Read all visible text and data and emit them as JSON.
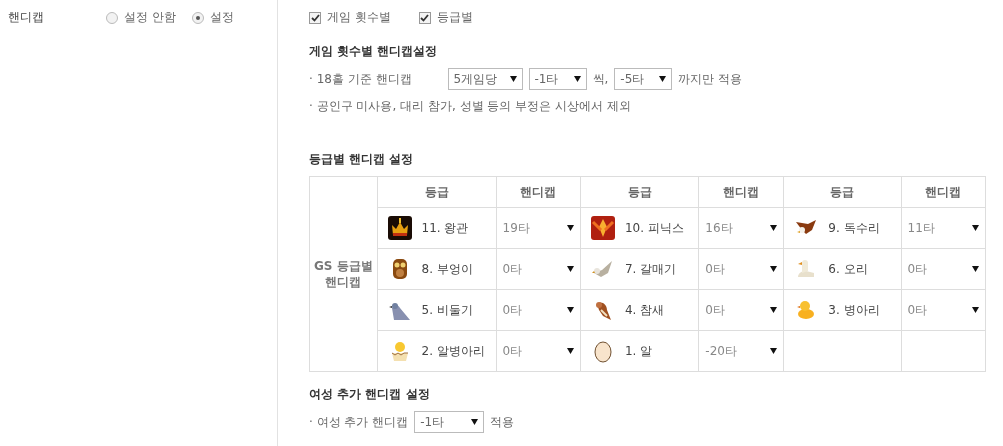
{
  "field_label": "핸디캡",
  "radios": [
    {
      "label": "설정 안함",
      "selected": false
    },
    {
      "label": "설정",
      "selected": true
    }
  ],
  "checkboxes": [
    {
      "label": "게임 횟수별",
      "checked": true
    },
    {
      "label": "등급별",
      "checked": true
    }
  ],
  "game_section": {
    "title": "게임 횟수별 핸디캡설정",
    "rule": {
      "label": "· 18홀 기준 핸디캡",
      "per_games": "5게임당",
      "step": "-1타",
      "step_suffix": "씩,",
      "limit": "-5타",
      "limit_suffix": "까지만 적용"
    },
    "note": "· 공인구 미사용, 대리 참가, 성별 등의 부정은 시상에서 제외"
  },
  "grade_section": {
    "title": "등급별 핸디캡 설정",
    "row_header": "GS 등급별 핸디캡",
    "columns": [
      "등급",
      "핸디캡",
      "등급",
      "핸디캡",
      "등급",
      "핸디캡"
    ],
    "grades": [
      {
        "name": "11. 왕관",
        "handicap": "19타"
      },
      {
        "name": "10. 피닉스",
        "handicap": "16타"
      },
      {
        "name": "9. 독수리",
        "handicap": "11타"
      },
      {
        "name": "8. 부엉이",
        "handicap": "0타"
      },
      {
        "name": "7. 갈매기",
        "handicap": "0타"
      },
      {
        "name": "6. 오리",
        "handicap": "0타"
      },
      {
        "name": "5. 비둘기",
        "handicap": "0타"
      },
      {
        "name": "4. 참새",
        "handicap": "0타"
      },
      {
        "name": "3. 병아리",
        "handicap": "0타"
      },
      {
        "name": "2. 알병아리",
        "handicap": "0타"
      },
      {
        "name": "1. 알",
        "handicap": "-20타"
      }
    ]
  },
  "female_section": {
    "title": "여성 추가 핸디캡 설정",
    "label": "· 여성 추가 핸디캡",
    "value": "-1타",
    "suffix": "적용"
  }
}
